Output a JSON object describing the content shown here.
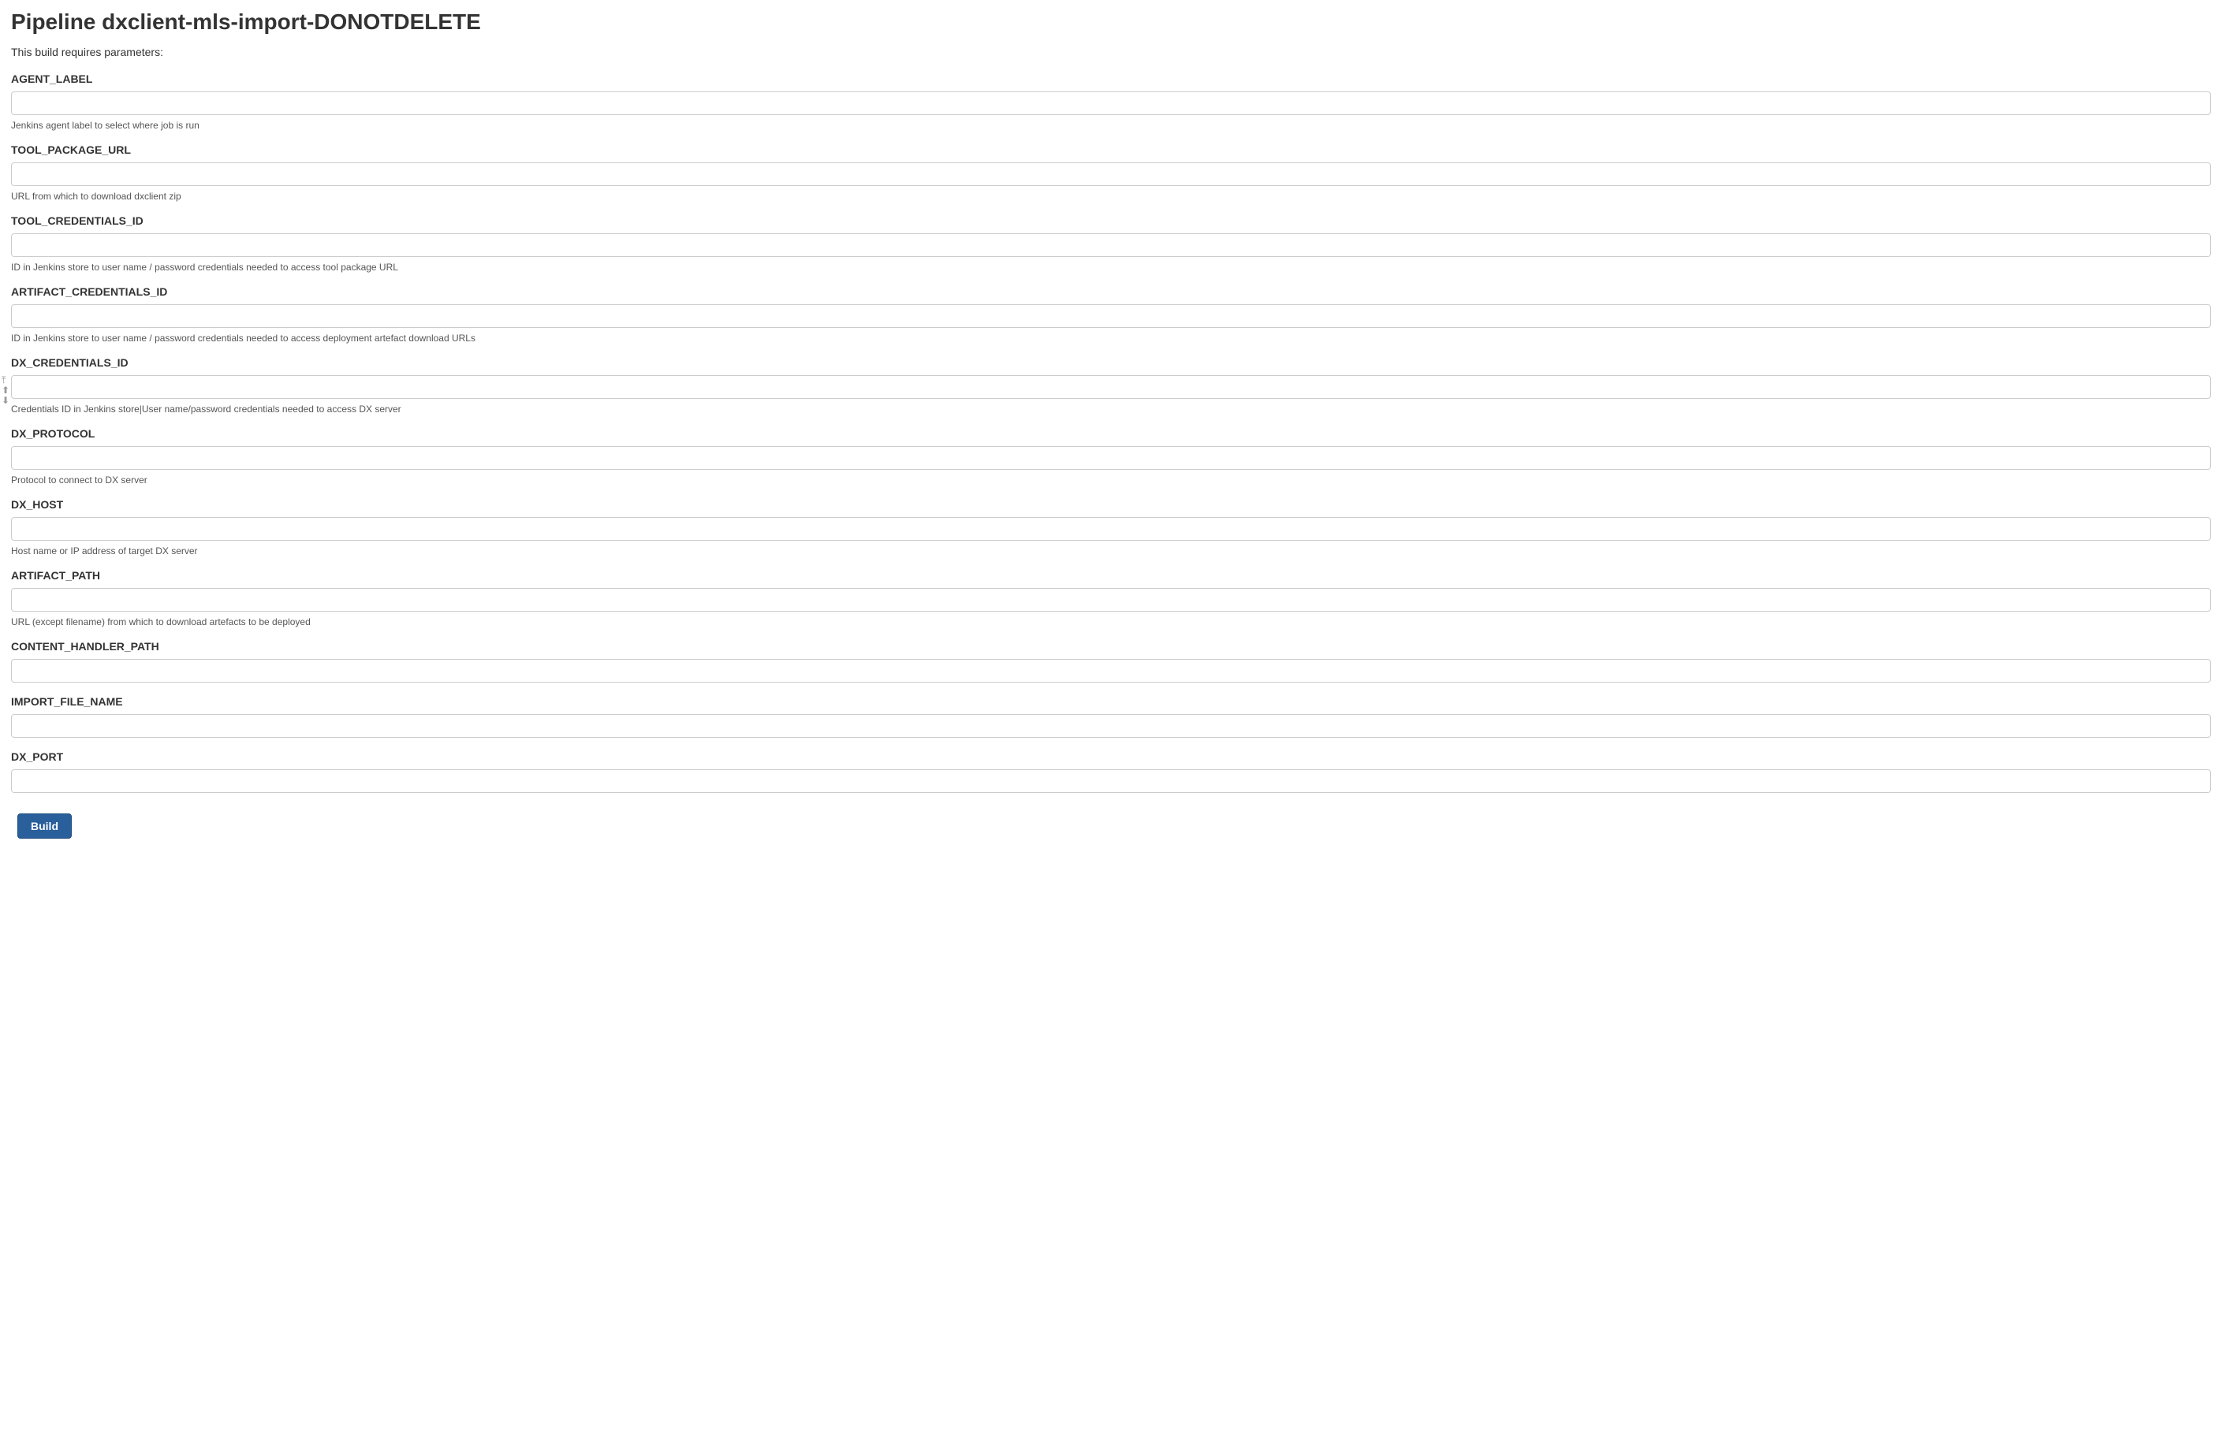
{
  "page": {
    "title": "Pipeline dxclient-mls-import-DONOTDELETE",
    "intro": "This build requires parameters:",
    "build_label": "Build"
  },
  "params": [
    {
      "label": "AGENT_LABEL",
      "value": "",
      "desc": "Jenkins agent label to select where job is run",
      "show_handles": false
    },
    {
      "label": "TOOL_PACKAGE_URL",
      "value": "",
      "desc": "URL from which to download dxclient zip",
      "show_handles": false
    },
    {
      "label": "TOOL_CREDENTIALS_ID",
      "value": "",
      "desc": "ID in Jenkins store to user name / password credentials needed to access tool package URL",
      "show_handles": false
    },
    {
      "label": "ARTIFACT_CREDENTIALS_ID",
      "value": "",
      "desc": "ID in Jenkins store to user name / password credentials needed to access deployment artefact download URLs",
      "show_handles": false
    },
    {
      "label": "DX_CREDENTIALS_ID",
      "value": "",
      "desc": "Credentials ID in Jenkins store|User name/password credentials needed to access DX server",
      "show_handles": true
    },
    {
      "label": "DX_PROTOCOL",
      "value": "",
      "desc": "Protocol to connect to DX server",
      "show_handles": false
    },
    {
      "label": "DX_HOST",
      "value": "",
      "desc": "Host name or IP address of target DX server",
      "show_handles": false
    },
    {
      "label": "ARTIFACT_PATH",
      "value": "",
      "desc": "URL (except filename) from which to download artefacts to be deployed",
      "show_handles": false
    },
    {
      "label": "CONTENT_HANDLER_PATH",
      "value": "",
      "desc": "",
      "show_handles": false
    },
    {
      "label": "IMPORT_FILE_NAME",
      "value": "",
      "desc": "",
      "show_handles": false
    },
    {
      "label": "DX_PORT",
      "value": "",
      "desc": "",
      "show_handles": false
    }
  ]
}
